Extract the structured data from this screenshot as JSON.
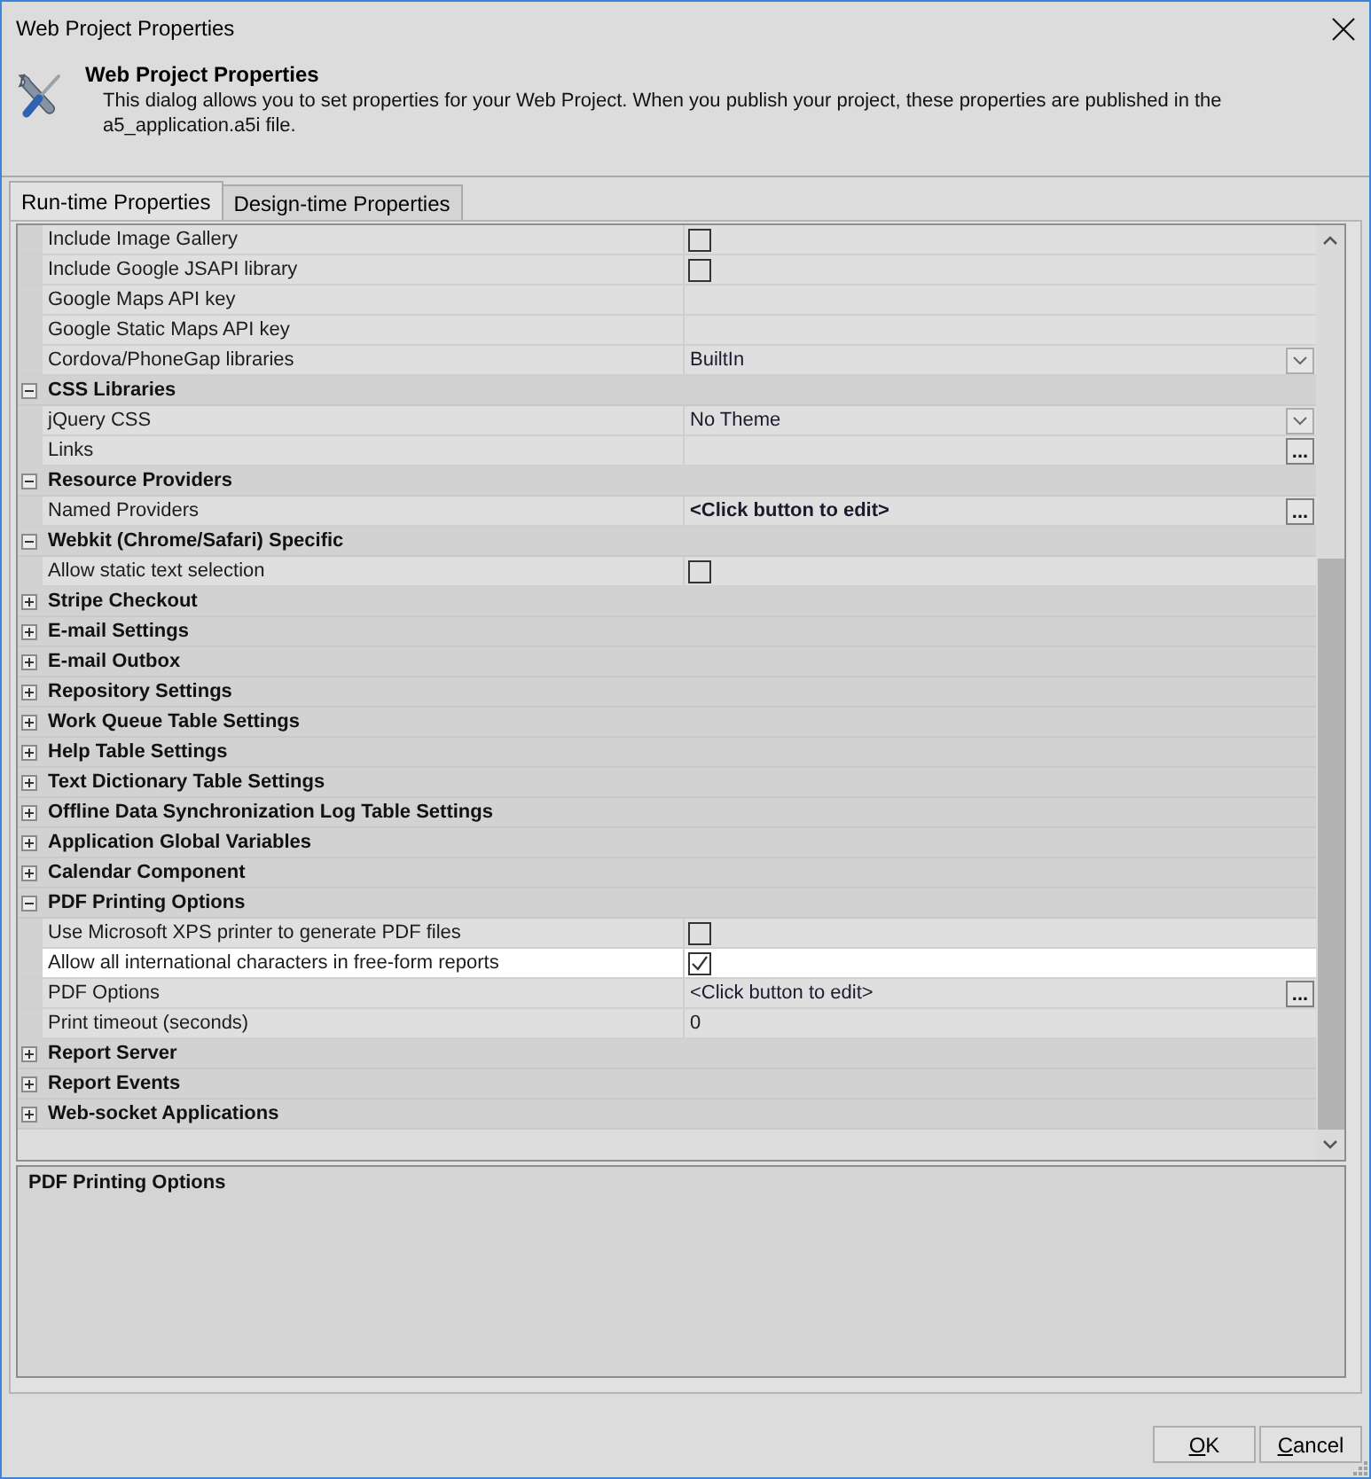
{
  "window": {
    "title": "Web Project Properties"
  },
  "header": {
    "title": "Web Project Properties",
    "description": "This dialog allows you to set properties for your Web Project. When you publish your project, these properties are published in the a5_application.a5i file."
  },
  "tabs": [
    {
      "label": "Run-time Properties",
      "selected": true
    },
    {
      "label": "Design-time Properties",
      "selected": false
    }
  ],
  "property_grid": {
    "items": [
      {
        "kind": "checkbox",
        "name": "Include Image Gallery",
        "checked": false,
        "selected": false
      },
      {
        "kind": "checkbox",
        "name": "Include Google JSAPI library",
        "checked": false,
        "selected": false
      },
      {
        "kind": "text",
        "name": "Google Maps API key",
        "selected": false
      },
      {
        "kind": "text",
        "name": "Google Static Maps API key",
        "selected": false
      },
      {
        "kind": "dropdown",
        "name": "Cordova/PhoneGap libraries",
        "value": "BuiltIn",
        "bold": false,
        "selected": false
      },
      {
        "kind": "category",
        "name": "CSS Libraries",
        "expanded": true,
        "selected": false,
        "children": [
          {
            "kind": "dropdown",
            "name": "jQuery CSS",
            "value": "No Theme",
            "bold": false,
            "selected": false
          },
          {
            "kind": "ellipsis",
            "name": "Links",
            "button": "...",
            "selected": false
          }
        ]
      },
      {
        "kind": "category",
        "name": "Resource Providers",
        "expanded": true,
        "selected": false,
        "children": [
          {
            "kind": "ellipsis",
            "name": "Named Providers",
            "value": "<Click button to edit>",
            "bold": true,
            "button": "...",
            "selected": false
          }
        ]
      },
      {
        "kind": "category",
        "name": "Webkit (Chrome/Safari) Specific",
        "expanded": true,
        "selected": false,
        "children": [
          {
            "kind": "checkbox",
            "name": "Allow static text selection",
            "checked": false,
            "selected": false
          }
        ]
      },
      {
        "kind": "category",
        "name": "Stripe Checkout",
        "expanded": false,
        "selected": false
      },
      {
        "kind": "category",
        "name": "E-mail Settings",
        "expanded": false,
        "selected": false
      },
      {
        "kind": "category",
        "name": "E-mail Outbox",
        "expanded": false,
        "selected": false
      },
      {
        "kind": "category",
        "name": "Repository Settings",
        "expanded": false,
        "selected": false
      },
      {
        "kind": "category",
        "name": "Work Queue Table Settings",
        "expanded": false,
        "selected": false
      },
      {
        "kind": "category",
        "name": "Help Table Settings",
        "expanded": false,
        "selected": false
      },
      {
        "kind": "category",
        "name": "Text Dictionary Table Settings",
        "expanded": false,
        "selected": false
      },
      {
        "kind": "category",
        "name": "Offline Data Synchronization Log Table Settings",
        "expanded": false,
        "selected": false
      },
      {
        "kind": "category",
        "name": "Application Global Variables",
        "expanded": false,
        "selected": false
      },
      {
        "kind": "category",
        "name": "Calendar Component",
        "expanded": false,
        "selected": false
      },
      {
        "kind": "category",
        "name": "PDF Printing Options",
        "expanded": true,
        "selected": false,
        "children": [
          {
            "kind": "checkbox",
            "name": "Use Microsoft XPS printer to generate PDF files",
            "checked": false,
            "selected": false
          },
          {
            "kind": "checkbox",
            "name": "Allow all international characters in free-form reports",
            "checked": true,
            "selected": true
          },
          {
            "kind": "ellipsis",
            "name": "PDF Options",
            "value": "<Click button to edit>",
            "bold": false,
            "button": "...",
            "selected": false
          },
          {
            "kind": "text",
            "name": "Print timeout (seconds)",
            "value": "0",
            "bold": false,
            "selected": false
          }
        ]
      },
      {
        "kind": "category",
        "name": "Report Server",
        "expanded": false,
        "selected": false
      },
      {
        "kind": "category",
        "name": "Report Events",
        "expanded": false,
        "selected": false
      },
      {
        "kind": "category",
        "name": "Web-socket Applications",
        "expanded": false,
        "selected": false
      }
    ]
  },
  "description_panel": {
    "title": "PDF Printing Options"
  },
  "buttons": [
    {
      "label_parts": [
        {
          "text": "O",
          "underlined": true
        },
        {
          "text": "K",
          "underlined": false
        }
      ]
    },
    {
      "label_parts": [
        {
          "text": "C",
          "underlined": true
        },
        {
          "text": "ancel",
          "underlined": false
        }
      ]
    }
  ]
}
